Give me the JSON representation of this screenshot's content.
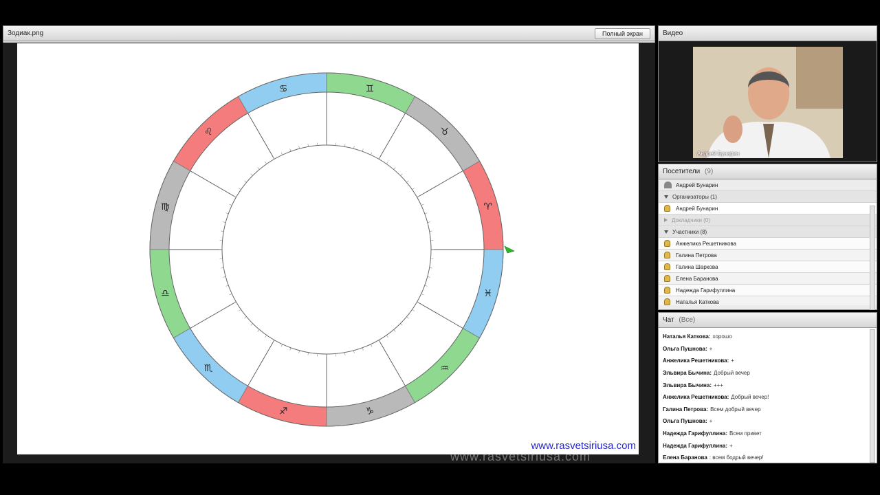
{
  "share": {
    "title": "Зодиак.png",
    "fullscreen_label": "Полный экран",
    "url": "www.rasvetsiriusa.com",
    "watermark": "www.rasvetsiriusa.com"
  },
  "zodiac": {
    "signs": [
      "♈",
      "♉",
      "♊",
      "♋",
      "♌",
      "♍",
      "♎",
      "♏",
      "♐",
      "♑",
      "♒",
      "♓"
    ],
    "colors": {
      "fire": "#f47c7c",
      "earth": "#b9b9b9",
      "air": "#8fd88f",
      "water": "#90cdf0"
    }
  },
  "video": {
    "title": "Видео",
    "name": "Андрей Бунарин"
  },
  "attendees": {
    "title": "Посетители",
    "count": "(9)",
    "me": "Андрей Бунарин",
    "host_group": "Организаторы (1)",
    "host": "Андрей Бунарин",
    "presenters_group": "Докладчики (0)",
    "participants_group": "Участники (8)",
    "participants": [
      "Анжелика Решетникова",
      "Галина Петрова",
      "Галина Шаркова",
      "Елена Баранова",
      "Надежда Гарифуллина",
      "Наталья Каткова"
    ]
  },
  "chat": {
    "title": "Чат",
    "tab": "(Все)",
    "messages": [
      {
        "author": "Наталья Каткова:",
        "text": "хорошо"
      },
      {
        "author": "Ольга Пушнова:",
        "text": "+"
      },
      {
        "author": "Анжелика Решетникова:",
        "text": "+"
      },
      {
        "author": "Эльвира Бычина:",
        "text": "Добрый вечер"
      },
      {
        "author": "Эльвира Бычина:",
        "text": "+++"
      },
      {
        "author": "Анжелика Решетникова:",
        "text": "Добрый вечер!"
      },
      {
        "author": "Галина Петрова:",
        "text": "Всем добрый вечер"
      },
      {
        "author": "Ольга Пушнова:",
        "text": "+"
      },
      {
        "author": "Надежда Гарифуллина:",
        "text": "Всем привет"
      },
      {
        "author": "Надежда Гарифуллина:",
        "text": "+"
      },
      {
        "author": "Елена Баранова",
        "text": ": всем бодрый вечер!"
      }
    ]
  }
}
